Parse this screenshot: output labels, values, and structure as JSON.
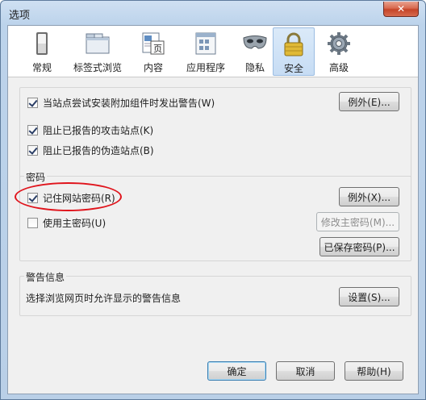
{
  "window": {
    "title": "选项",
    "close_icon": "close-icon"
  },
  "tabs": [
    {
      "label": "常规",
      "icon": "switch-icon"
    },
    {
      "label": "标签式浏览",
      "icon": "tabs-icon"
    },
    {
      "label": "内容",
      "icon": "content-page-icon"
    },
    {
      "label": "应用程序",
      "icon": "applications-icon"
    },
    {
      "label": "隐私",
      "icon": "mask-icon"
    },
    {
      "label": "安全",
      "icon": "padlock-icon"
    },
    {
      "label": "高级",
      "icon": "gear-icon"
    }
  ],
  "active_tab": "安全",
  "general": {
    "warn_addons": {
      "label": "当站点尝试安装附加组件时发出警告(W)",
      "checked": true
    },
    "exceptions_button": "例外(E)...",
    "block_attack": {
      "label": "阻止已报告的攻击站点(K)",
      "checked": true
    },
    "block_forgery": {
      "label": "阻止已报告的伪造站点(B)",
      "checked": true
    }
  },
  "passwords": {
    "caption": "密码",
    "remember": {
      "label": "记住网站密码(R)",
      "checked": true
    },
    "exceptions_button": "例外(X)...",
    "master": {
      "label": "使用主密码(U)",
      "checked": false
    },
    "change_master_button": "修改主密码(M)...",
    "saved_button": "已保存密码(P)..."
  },
  "warnings": {
    "caption": "警告信息",
    "description": "选择浏览网页时允许显示的警告信息",
    "settings_button": "设置(S)..."
  },
  "footer": {
    "ok": "确定",
    "cancel": "取消",
    "help": "帮助(H)"
  },
  "colors": {
    "annotation": "#e0141c",
    "active_tab": "#c6dcf4"
  }
}
